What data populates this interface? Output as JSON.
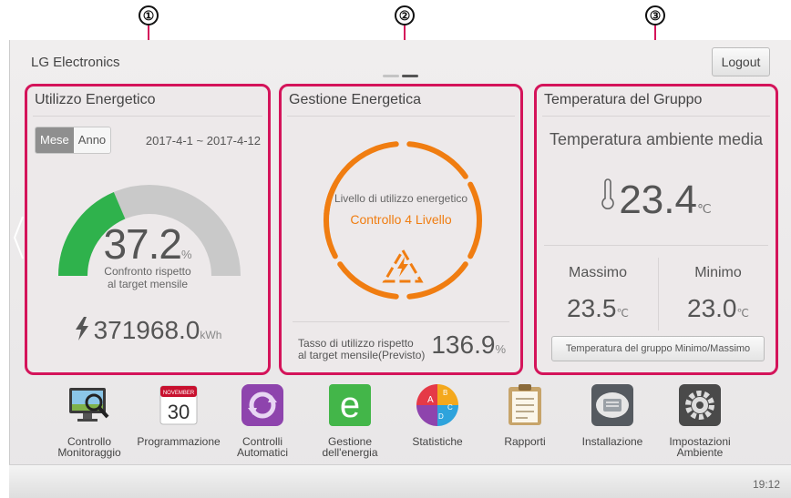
{
  "callouts": [
    "①",
    "②",
    "③"
  ],
  "header": {
    "brand": "LG Electronics",
    "logout_label": "Logout"
  },
  "panel_energy_use": {
    "title": "Utilizzo Energetico",
    "toggle": [
      "Mese",
      "Anno"
    ],
    "selected_toggle": "Mese",
    "date_range": "2017-4-1 ~ 2017-4-12",
    "gauge_percent": 37.2,
    "percent_value": "37.2",
    "percent_unit": "%",
    "caption_line1": "Confronto rispetto",
    "caption_line2": "al target mensile",
    "energy_value": "371968.0",
    "energy_unit": "kWh",
    "colors": {
      "gauge_fill": "#2fb24c",
      "gauge_track": "#c9c9c9"
    }
  },
  "panel_energy_mgmt": {
    "title": "Gestione Energetica",
    "ring_label": "Livello di utilizzo energetico",
    "ring_level": "Controllo 4 Livello",
    "rate_label_line1": "Tasso di utilizzo rispetto",
    "rate_label_line2": "al target mensile(Previsto)",
    "rate_value": "136.9",
    "rate_unit": "%",
    "colors": {
      "ring": "#f07d11"
    }
  },
  "panel_group_temp": {
    "title": "Temperatura del Gruppo",
    "avg_label": "Temperatura ambiente media",
    "avg_value": "23.4",
    "unit": "℃",
    "max_label": "Massimo",
    "max_value": "23.5",
    "min_label": "Minimo",
    "min_value": "23.0",
    "button_label": "Temperatura del gruppo Minimo/Massimo"
  },
  "dock": {
    "items": [
      {
        "label": "Controllo\nMonitoraggio",
        "icon": "monitor-icon"
      },
      {
        "label": "Programmazione",
        "icon": "calendar-icon",
        "calendar_month": "NOVEMBER",
        "calendar_day": "30"
      },
      {
        "label": "Controlli\nAutomatici",
        "icon": "cycle-icon"
      },
      {
        "label": "Gestione\ndell'energia",
        "icon": "energy-e-icon"
      },
      {
        "label": "Statistiche",
        "icon": "pie-icon",
        "pie_letters": [
          "A",
          "B",
          "C",
          "D"
        ]
      },
      {
        "label": "Rapporti",
        "icon": "clipboard-icon"
      },
      {
        "label": "Installazione",
        "icon": "ceiling-unit-icon"
      },
      {
        "label": "Impostazioni\nAmbiente",
        "icon": "gear-icon"
      }
    ]
  },
  "status": {
    "clock": "19:12"
  },
  "accent": "#d4145a"
}
